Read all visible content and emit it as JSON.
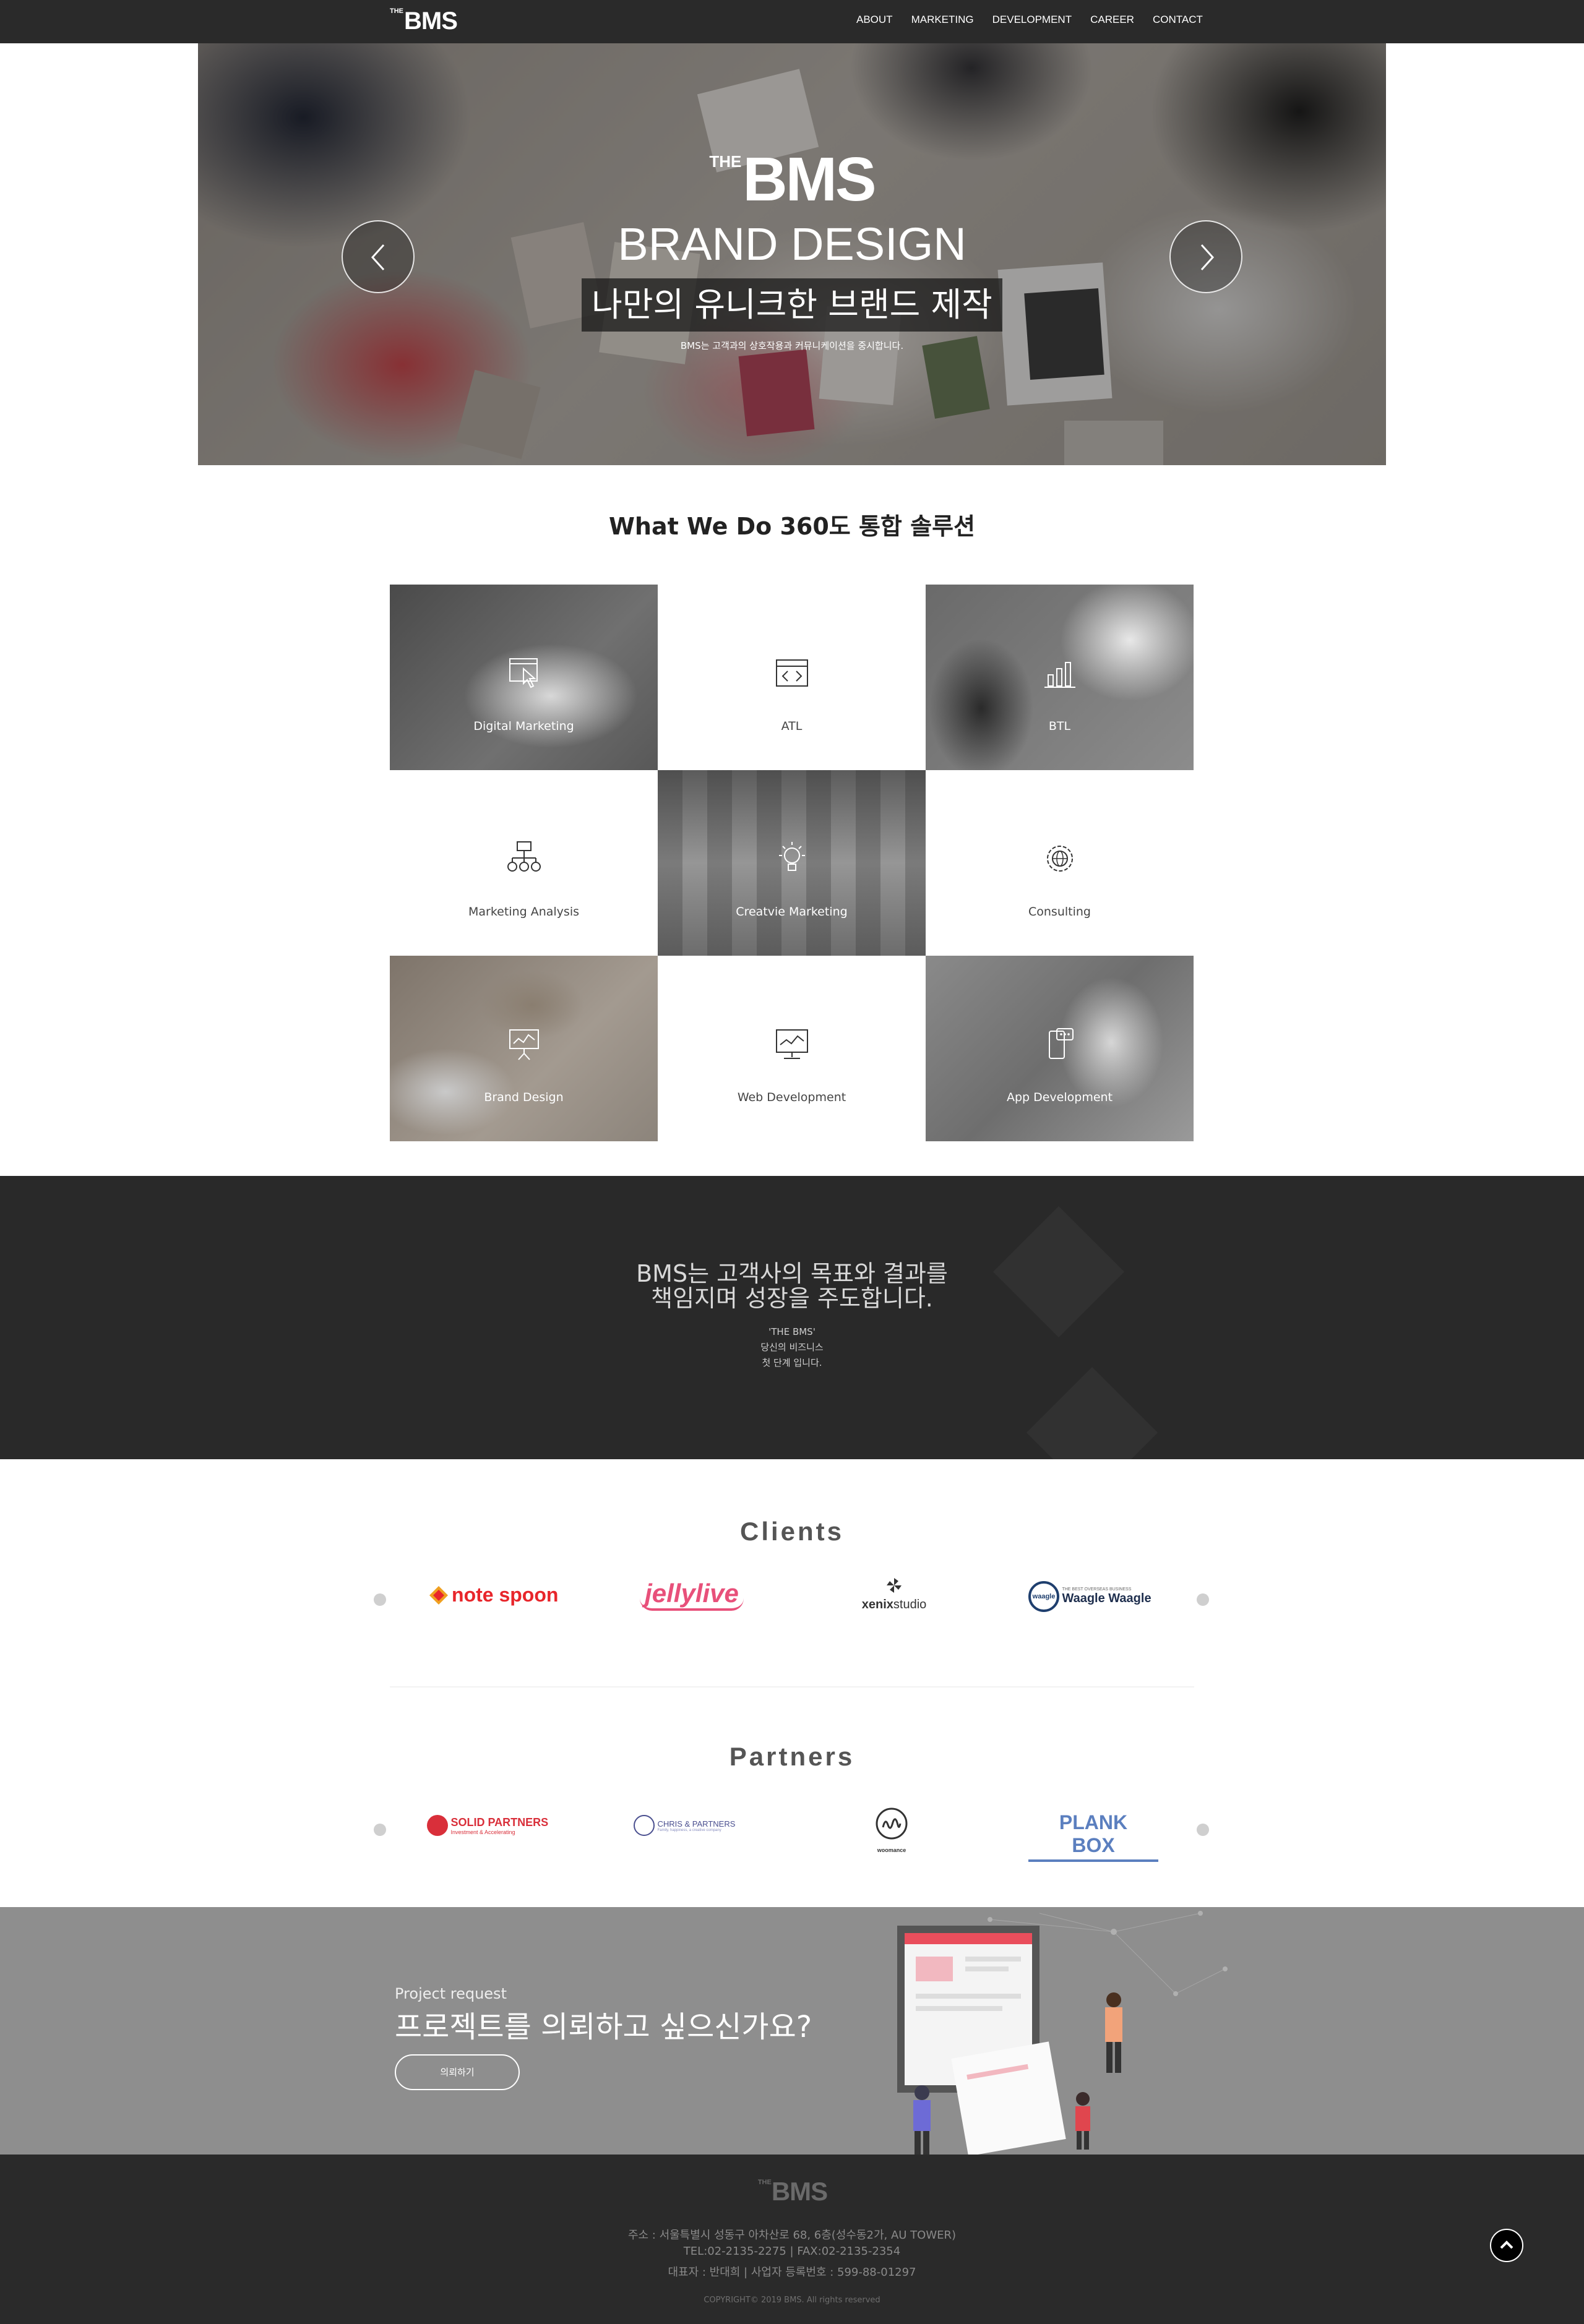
{
  "header": {
    "logo_the": "THE",
    "logo": "BMS",
    "nav": [
      "ABOUT",
      "MARKETING",
      "DEVELOPMENT",
      "CAREER",
      "CONTACT"
    ]
  },
  "hero": {
    "logo_the": "THE",
    "logo": "BMS",
    "title": "BRAND DESIGN",
    "subtitle": "나만의 유니크한 브랜드 제작",
    "desc": "BMS는 고객과의 상호작용과 커뮤니케이션을 중시합니다.",
    "prev_icon": "chevron-left-icon",
    "next_icon": "chevron-right-icon"
  },
  "services": {
    "title": "What We Do 360도 통합 솔루션",
    "items": [
      {
        "label": "Digital Marketing",
        "icon": "pointer-click-icon"
      },
      {
        "label": "ATL",
        "icon": "code-window-icon"
      },
      {
        "label": "BTL",
        "icon": "bar-chart-icon"
      },
      {
        "label": "Marketing Analysis",
        "icon": "hierarchy-abc-icon"
      },
      {
        "label": "Creatvie Marketing",
        "icon": "lightbulb-icon"
      },
      {
        "label": "Consulting",
        "icon": "gear-globe-icon"
      },
      {
        "label": "Brand Design",
        "icon": "presentation-board-icon"
      },
      {
        "label": "Web Development",
        "icon": "monitor-graph-icon"
      },
      {
        "label": "App Development",
        "icon": "mobile-chat-icon"
      }
    ]
  },
  "band": {
    "line1": "BMS는 고객사의 목표와 결과를",
    "line2": "책임지며 성장을 주도합니다.",
    "small1": "'THE BMS'",
    "small2": "당신의 비즈니스",
    "small3": "첫 단계 입니다."
  },
  "clients": {
    "title": "Clients",
    "logos": [
      {
        "name": "note spoon"
      },
      {
        "name": "jellylive"
      },
      {
        "name": "xenixstudio",
        "part1": "xenix",
        "part2": "studio"
      },
      {
        "name": "Waagle Waagle",
        "tag": "THE BEST OVERSEAS BUSINESS",
        "mark": "waagle"
      }
    ]
  },
  "partners": {
    "title": "Partners",
    "logos": [
      {
        "name": "SOLID PARTNERS",
        "sub": "Investment & Accelerating"
      },
      {
        "name": "CHRIS & PARTNERS",
        "sub": "Family, happiness, a creative company"
      },
      {
        "name": "woomance"
      },
      {
        "name": "PLANK BOX"
      }
    ]
  },
  "request": {
    "small": "Project request",
    "big": "프로젝트를 의뢰하고 싶으신가요?",
    "button": "의뢰하기"
  },
  "footer": {
    "logo_the": "THE",
    "logo": "BMS",
    "address": "주소 : 서울특별시 성동구 아차산로 68, 6층(성수동2가, AU TOWER)",
    "tel": "TEL:02-2135-2275 | FAX:02-2135-2354",
    "ceo": "대표자 : 반대희 | 사업자 등록번호 : 599-88-01297",
    "copyright": "COPYRIGHT© 2019 BMS. All rights reserved",
    "totop_icon": "chevron-up-icon"
  },
  "colors": {
    "header_bg": "#2a2a2a",
    "band_bg": "#292929",
    "request_bg": "#8e8e8e",
    "notespoon_red": "#e8262b",
    "jellylive_pink": "#e8507a",
    "solid_red": "#d92f3a",
    "plankbox_blue": "#5b7fbf"
  }
}
